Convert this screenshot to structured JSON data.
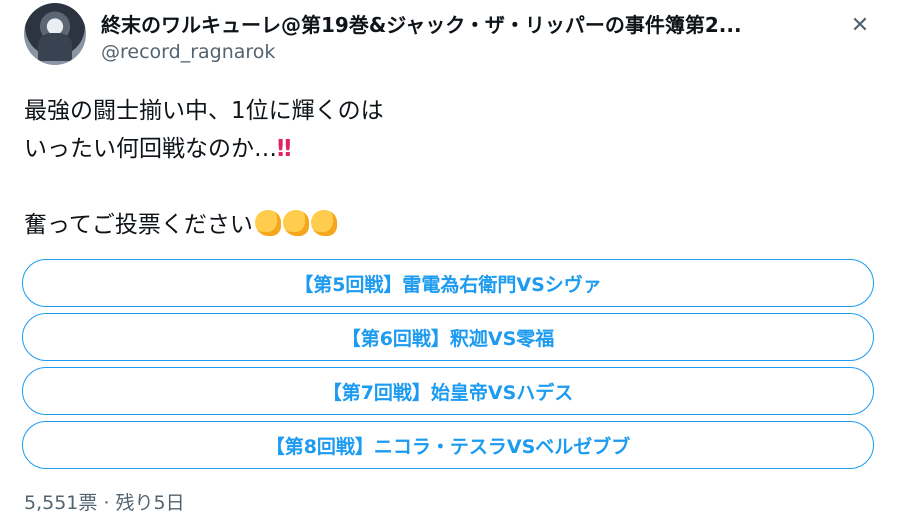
{
  "tweet": {
    "display_name": "終末のワルキューレ@第19巻&ジャック・ザ・リッパーの事件簿第2...",
    "handle": "@record_ragnarok",
    "close_icon": "close-icon",
    "text_line1": "最強の闘士揃い中、1位に輝くのは",
    "text_line2": "いったい何回戦なのか…",
    "text_line2_emoji": "‼",
    "text_line4": "奮ってご投票ください",
    "flexed_biceps_emoji_count": 3
  },
  "poll": {
    "options": [
      {
        "label": "【第5回戦】雷電為右衛門VSシヴァ"
      },
      {
        "label": "【第6回戦】釈迦VS零福"
      },
      {
        "label": "【第7回戦】始皇帝VSハデス"
      },
      {
        "label": "【第8回戦】ニコラ・テスラVSベルゼブブ"
      }
    ],
    "votes": "5,551票",
    "separator": "·",
    "remaining": "残り5日"
  },
  "colors": {
    "accent": "#1d9bf0",
    "text": "#0f1419",
    "secondary": "#536471"
  }
}
